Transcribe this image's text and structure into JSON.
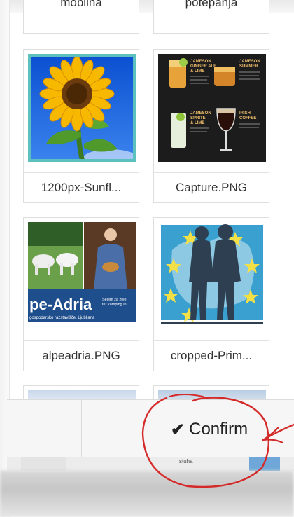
{
  "media": {
    "items": [
      {
        "label": "mobilna",
        "thumb": "partial",
        "selected": false
      },
      {
        "label": "potepanja",
        "thumb": "partial",
        "selected": false
      },
      {
        "label": "1200px-Sunfl...",
        "thumb": "sunflower-image",
        "selected": true
      },
      {
        "label": "Capture.PNG",
        "thumb": "drinks-menu-image",
        "selected": false
      },
      {
        "label": "alpeadria.PNG",
        "thumb": "alpeadria-poster-image",
        "selected": false
      },
      {
        "label": "cropped-Prim...",
        "thumb": "europe-couple-image",
        "selected": false
      }
    ],
    "capture_text": {
      "h1": "JAMESON",
      "h1b": "GINGER ALE",
      "h1c": "& LIME",
      "h2": "JAMESON",
      "h2b": "SUMMER",
      "h3": "JAMESON",
      "h3b": "SPRITE",
      "h3c": "& LIME",
      "h4": "IRISH",
      "h4b": "COFFEE"
    },
    "alpeadria_text": {
      "banner": "pe-Adria",
      "tag1": "Sejem za zele",
      "tag2": "ter kamping in",
      "footer": "gospodarsko razstavišče, Ljubljana"
    },
    "under_label": "stuha"
  },
  "actions": {
    "confirm_label": "Confirm",
    "confirm_icon": "check-icon"
  },
  "colors": {
    "selected_outline": "#5bc0be",
    "annotation": "#d42a2a"
  }
}
